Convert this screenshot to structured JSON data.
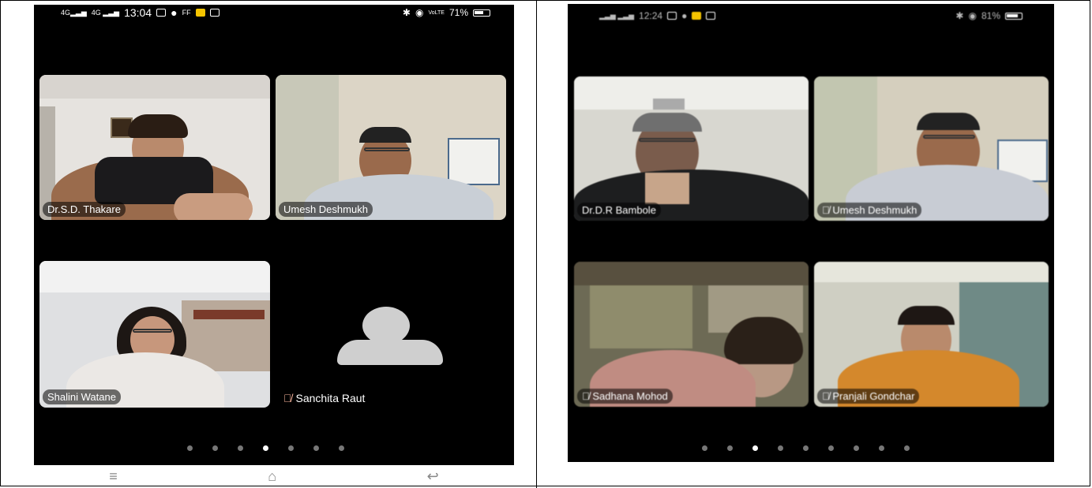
{
  "left_phone": {
    "status": {
      "network": "4G",
      "time": "13:04",
      "battery": "71%",
      "battery_level": 0.71
    },
    "participants": [
      {
        "name": "Dr.S.D. Thakare"
      },
      {
        "name": "Umesh Deshmukh"
      },
      {
        "name": "Shalini Watane"
      },
      {
        "name": "Sanchita Raut",
        "muted": true,
        "no_video": true
      }
    ],
    "page_count": 7,
    "active_page": 4,
    "navbar": {
      "menu_icon": "≡",
      "home_icon": "⌂",
      "back_icon": "↩"
    }
  },
  "right_phone": {
    "status": {
      "time": "12:24",
      "battery": "81%"
    },
    "participants": [
      {
        "name": "Dr.D.R Bambole"
      },
      {
        "name": "Umesh Deshmukh"
      },
      {
        "name": "Sadhana Mohod"
      },
      {
        "name": "Pranjali Gondchar"
      }
    ],
    "page_count": 9,
    "active_page": 3
  },
  "colors": {
    "background": "#000000",
    "tag_bg": "rgba(0,0,0,0.55)",
    "avatar_placeholder": "#cfcfcf"
  }
}
